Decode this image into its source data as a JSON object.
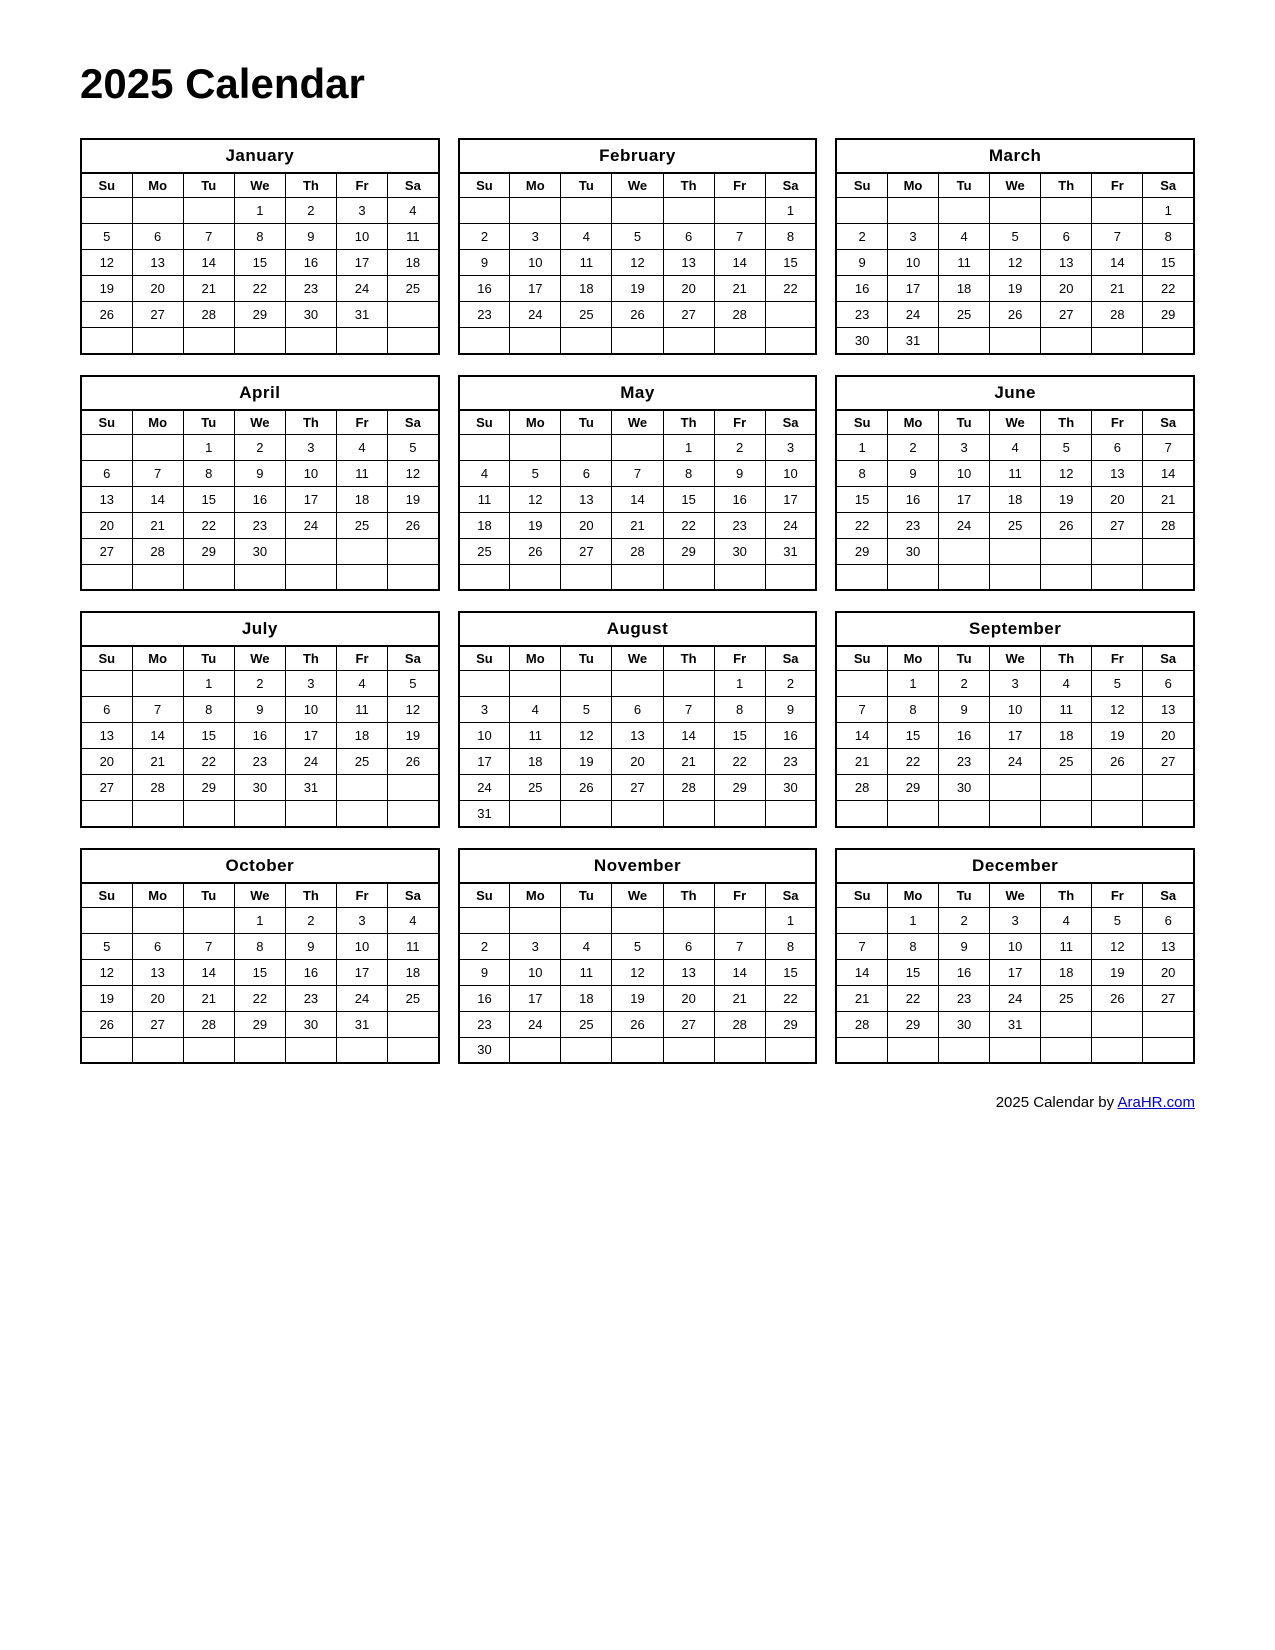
{
  "title": "2025 Calendar",
  "footer": {
    "text": "2025  Calendar by ",
    "link_text": "AraHR.com",
    "link_url": "AraHR.com"
  },
  "day_headers": [
    "Su",
    "Mo",
    "Tu",
    "We",
    "Th",
    "Fr",
    "Sa"
  ],
  "months": [
    {
      "name": "January",
      "weeks": [
        [
          "",
          "",
          "",
          "1",
          "2",
          "3",
          "4"
        ],
        [
          "5",
          "6",
          "7",
          "8",
          "9",
          "10",
          "11"
        ],
        [
          "12",
          "13",
          "14",
          "15",
          "16",
          "17",
          "18"
        ],
        [
          "19",
          "20",
          "21",
          "22",
          "23",
          "24",
          "25"
        ],
        [
          "26",
          "27",
          "28",
          "29",
          "30",
          "31",
          ""
        ],
        [
          "",
          "",
          "",
          "",
          "",
          "",
          ""
        ]
      ]
    },
    {
      "name": "February",
      "weeks": [
        [
          "",
          "",
          "",
          "",
          "",
          "",
          "1"
        ],
        [
          "2",
          "3",
          "4",
          "5",
          "6",
          "7",
          "8"
        ],
        [
          "9",
          "10",
          "11",
          "12",
          "13",
          "14",
          "15"
        ],
        [
          "16",
          "17",
          "18",
          "19",
          "20",
          "21",
          "22"
        ],
        [
          "23",
          "24",
          "25",
          "26",
          "27",
          "28",
          ""
        ],
        [
          "",
          "",
          "",
          "",
          "",
          "",
          ""
        ]
      ]
    },
    {
      "name": "March",
      "weeks": [
        [
          "",
          "",
          "",
          "",
          "",
          "",
          "1"
        ],
        [
          "2",
          "3",
          "4",
          "5",
          "6",
          "7",
          "8"
        ],
        [
          "9",
          "10",
          "11",
          "12",
          "13",
          "14",
          "15"
        ],
        [
          "16",
          "17",
          "18",
          "19",
          "20",
          "21",
          "22"
        ],
        [
          "23",
          "24",
          "25",
          "26",
          "27",
          "28",
          "29"
        ],
        [
          "30",
          "31",
          "",
          "",
          "",
          "",
          ""
        ]
      ]
    },
    {
      "name": "April",
      "weeks": [
        [
          "",
          "",
          "1",
          "2",
          "3",
          "4",
          "5"
        ],
        [
          "6",
          "7",
          "8",
          "9",
          "10",
          "11",
          "12"
        ],
        [
          "13",
          "14",
          "15",
          "16",
          "17",
          "18",
          "19"
        ],
        [
          "20",
          "21",
          "22",
          "23",
          "24",
          "25",
          "26"
        ],
        [
          "27",
          "28",
          "29",
          "30",
          "",
          "",
          ""
        ],
        [
          "",
          "",
          "",
          "",
          "",
          "",
          ""
        ]
      ]
    },
    {
      "name": "May",
      "weeks": [
        [
          "",
          "",
          "",
          "",
          "1",
          "2",
          "3"
        ],
        [
          "4",
          "5",
          "6",
          "7",
          "8",
          "9",
          "10"
        ],
        [
          "11",
          "12",
          "13",
          "14",
          "15",
          "16",
          "17"
        ],
        [
          "18",
          "19",
          "20",
          "21",
          "22",
          "23",
          "24"
        ],
        [
          "25",
          "26",
          "27",
          "28",
          "29",
          "30",
          "31"
        ],
        [
          "",
          "",
          "",
          "",
          "",
          "",
          ""
        ]
      ]
    },
    {
      "name": "June",
      "weeks": [
        [
          "1",
          "2",
          "3",
          "4",
          "5",
          "6",
          "7"
        ],
        [
          "8",
          "9",
          "10",
          "11",
          "12",
          "13",
          "14"
        ],
        [
          "15",
          "16",
          "17",
          "18",
          "19",
          "20",
          "21"
        ],
        [
          "22",
          "23",
          "24",
          "25",
          "26",
          "27",
          "28"
        ],
        [
          "29",
          "30",
          "",
          "",
          "",
          "",
          ""
        ],
        [
          "",
          "",
          "",
          "",
          "",
          "",
          ""
        ]
      ]
    },
    {
      "name": "July",
      "weeks": [
        [
          "",
          "",
          "1",
          "2",
          "3",
          "4",
          "5"
        ],
        [
          "6",
          "7",
          "8",
          "9",
          "10",
          "11",
          "12"
        ],
        [
          "13",
          "14",
          "15",
          "16",
          "17",
          "18",
          "19"
        ],
        [
          "20",
          "21",
          "22",
          "23",
          "24",
          "25",
          "26"
        ],
        [
          "27",
          "28",
          "29",
          "30",
          "31",
          "",
          ""
        ],
        [
          "",
          "",
          "",
          "",
          "",
          "",
          ""
        ]
      ]
    },
    {
      "name": "August",
      "weeks": [
        [
          "",
          "",
          "",
          "",
          "",
          "1",
          "2"
        ],
        [
          "3",
          "4",
          "5",
          "6",
          "7",
          "8",
          "9"
        ],
        [
          "10",
          "11",
          "12",
          "13",
          "14",
          "15",
          "16"
        ],
        [
          "17",
          "18",
          "19",
          "20",
          "21",
          "22",
          "23"
        ],
        [
          "24",
          "25",
          "26",
          "27",
          "28",
          "29",
          "30"
        ],
        [
          "31",
          "",
          "",
          "",
          "",
          "",
          ""
        ]
      ]
    },
    {
      "name": "September",
      "weeks": [
        [
          "",
          "1",
          "2",
          "3",
          "4",
          "5",
          "6"
        ],
        [
          "7",
          "8",
          "9",
          "10",
          "11",
          "12",
          "13"
        ],
        [
          "14",
          "15",
          "16",
          "17",
          "18",
          "19",
          "20"
        ],
        [
          "21",
          "22",
          "23",
          "24",
          "25",
          "26",
          "27"
        ],
        [
          "28",
          "29",
          "30",
          "",
          "",
          "",
          ""
        ],
        [
          "",
          "",
          "",
          "",
          "",
          "",
          ""
        ]
      ]
    },
    {
      "name": "October",
      "weeks": [
        [
          "",
          "",
          "",
          "1",
          "2",
          "3",
          "4"
        ],
        [
          "5",
          "6",
          "7",
          "8",
          "9",
          "10",
          "11"
        ],
        [
          "12",
          "13",
          "14",
          "15",
          "16",
          "17",
          "18"
        ],
        [
          "19",
          "20",
          "21",
          "22",
          "23",
          "24",
          "25"
        ],
        [
          "26",
          "27",
          "28",
          "29",
          "30",
          "31",
          ""
        ],
        [
          "",
          "",
          "",
          "",
          "",
          "",
          ""
        ]
      ]
    },
    {
      "name": "November",
      "weeks": [
        [
          "",
          "",
          "",
          "",
          "",
          "",
          "1"
        ],
        [
          "2",
          "3",
          "4",
          "5",
          "6",
          "7",
          "8"
        ],
        [
          "9",
          "10",
          "11",
          "12",
          "13",
          "14",
          "15"
        ],
        [
          "16",
          "17",
          "18",
          "19",
          "20",
          "21",
          "22"
        ],
        [
          "23",
          "24",
          "25",
          "26",
          "27",
          "28",
          "29"
        ],
        [
          "30",
          "",
          "",
          "",
          "",
          "",
          ""
        ]
      ]
    },
    {
      "name": "December",
      "weeks": [
        [
          "",
          "1",
          "2",
          "3",
          "4",
          "5",
          "6"
        ],
        [
          "7",
          "8",
          "9",
          "10",
          "11",
          "12",
          "13"
        ],
        [
          "14",
          "15",
          "16",
          "17",
          "18",
          "19",
          "20"
        ],
        [
          "21",
          "22",
          "23",
          "24",
          "25",
          "26",
          "27"
        ],
        [
          "28",
          "29",
          "30",
          "31",
          "",
          "",
          ""
        ],
        [
          "",
          "",
          "",
          "",
          "",
          "",
          ""
        ]
      ]
    }
  ]
}
